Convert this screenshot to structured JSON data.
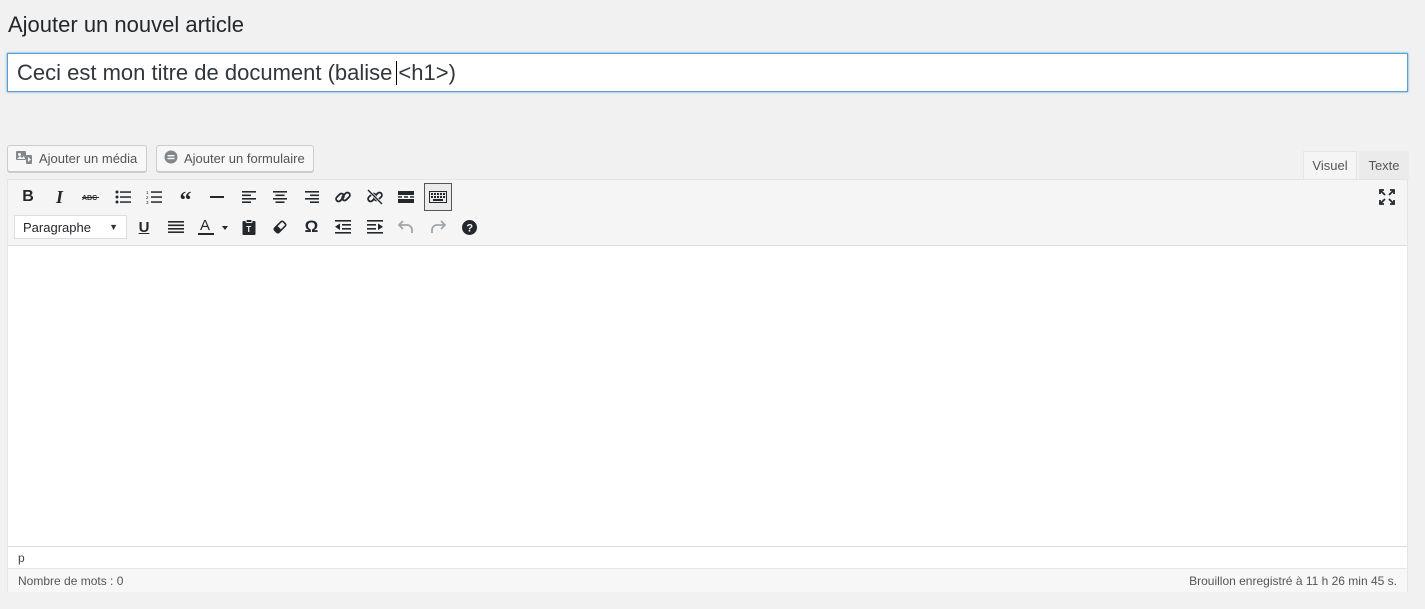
{
  "page": {
    "title": "Ajouter un nouvel article"
  },
  "post_title": {
    "value_before_caret": "Ceci est mon titre de document (balise",
    "value_after_caret": "<h1>)"
  },
  "media_buttons": {
    "add_media": "Ajouter un média",
    "add_form": "Ajouter un formulaire"
  },
  "editor_tabs": {
    "visual": "Visuel",
    "text": "Texte",
    "active": "visual"
  },
  "toolbar": {
    "row1": [
      "bold-icon",
      "italic-icon",
      "strikethrough-icon",
      "bullet-list-icon",
      "numbered-list-icon",
      "blockquote-icon",
      "horizontal-line-icon",
      "align-left-icon",
      "align-center-icon",
      "align-right-icon",
      "insert-link-icon",
      "remove-link-icon",
      "read-more-icon",
      "toolbar-toggle-icon"
    ],
    "row2": [
      "underline-icon",
      "justify-icon",
      "text-color-icon",
      "paste-text-icon",
      "clear-formatting-icon",
      "special-character-icon",
      "outdent-icon",
      "indent-icon",
      "undo-icon",
      "redo-icon",
      "help-icon"
    ],
    "format_select": {
      "selected": "Paragraphe"
    },
    "text_color_underline": "#23282d"
  },
  "editor": {
    "path": "p"
  },
  "status": {
    "word_count": "Nombre de mots : 0",
    "draft_saved": "Brouillon enregistré à 11 h 26 min 45 s."
  },
  "colors": {
    "focus_border": "#5b9dd9",
    "background": "#f1f1f1",
    "text": "#23282d"
  }
}
